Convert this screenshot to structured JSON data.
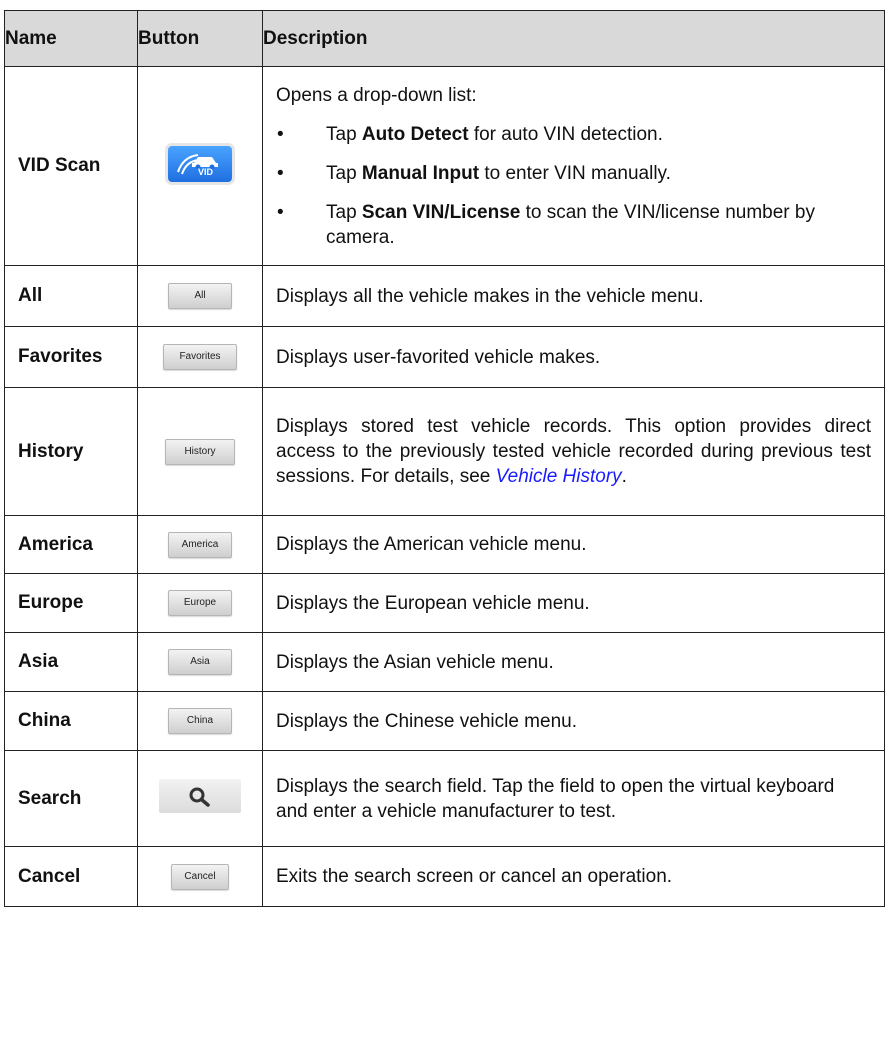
{
  "header": {
    "name": "Name",
    "button": "Button",
    "description": "Description"
  },
  "rows": [
    {
      "name": "VID Scan",
      "button": "VID",
      "intro": "Opens a drop-down list:",
      "bullets": [
        {
          "pre": "Tap ",
          "bold": "Auto Detect",
          "post": " for auto VIN detection."
        },
        {
          "pre": "Tap ",
          "bold": "Manual Input",
          "post": " to enter VIN manually."
        },
        {
          "pre": "Tap ",
          "bold": "Scan VIN/License",
          "post": " to scan the VIN/license number by camera."
        }
      ]
    },
    {
      "name": "All",
      "button": "All",
      "description": "Displays all the vehicle makes in the vehicle menu."
    },
    {
      "name": "Favorites",
      "button": "Favorites",
      "description": "Displays user-favorited vehicle makes."
    },
    {
      "name": "History",
      "button": "History",
      "description": "Displays stored test vehicle records. This option provides direct access to the previously tested vehicle recorded during previous test sessions. For details, see ",
      "link": "Vehicle History",
      "after": "."
    },
    {
      "name": "America",
      "button": "America",
      "description": "Displays the American vehicle menu."
    },
    {
      "name": "Europe",
      "button": "Europe",
      "description": "Displays the European vehicle menu."
    },
    {
      "name": "Asia",
      "button": "Asia",
      "description": "Displays the Asian vehicle menu."
    },
    {
      "name": "China",
      "button": "China",
      "description": "Displays the Chinese vehicle menu."
    },
    {
      "name": "Search",
      "icon": "search-icon",
      "description": "Displays the search field. Tap the field to open the virtual keyboard and enter a vehicle manufacturer to test."
    },
    {
      "name": "Cancel",
      "button": "Cancel",
      "description": "Exits the search screen or cancel an operation."
    }
  ],
  "bullet_glyph": "•"
}
